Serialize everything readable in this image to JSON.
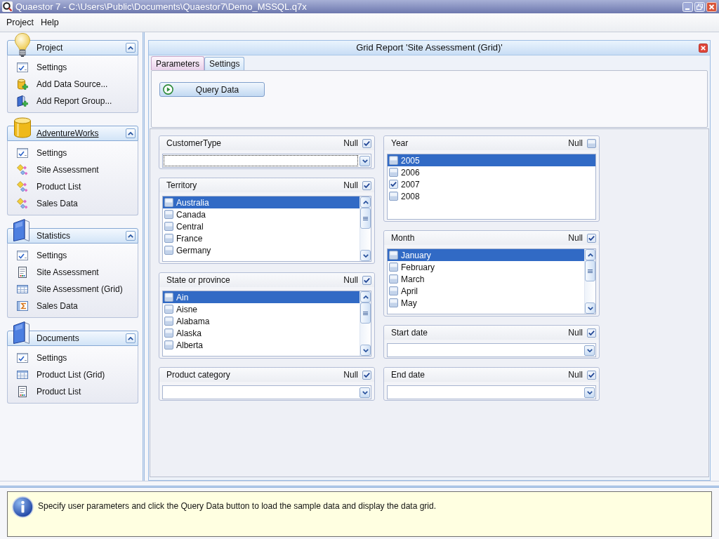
{
  "window": {
    "title": "Quaestor 7 - C:\\Users\\Public\\Documents\\Quaestor7\\Demo_MSSQL.q7x"
  },
  "menu": [
    {
      "label": "Project"
    },
    {
      "label": "Help"
    }
  ],
  "sidebar": {
    "groups": [
      {
        "title": "Project",
        "kind": "bulb",
        "hovered": false,
        "expanded": true,
        "items": [
          {
            "label": "Settings",
            "kind": "settings"
          },
          {
            "label": "Add Data Source...",
            "kind": "add-source"
          },
          {
            "label": "Add Report Group...",
            "kind": "add-group"
          }
        ]
      },
      {
        "title": "AdventureWorks",
        "kind": "database",
        "hovered": true,
        "expanded": true,
        "items": [
          {
            "label": "Settings",
            "kind": "settings"
          },
          {
            "label": "Site Assessment",
            "kind": "query"
          },
          {
            "label": "Product List",
            "kind": "query"
          },
          {
            "label": "Sales Data",
            "kind": "query"
          }
        ]
      },
      {
        "title": "Statistics",
        "kind": "book",
        "hovered": false,
        "expanded": true,
        "items": [
          {
            "label": "Settings",
            "kind": "settings"
          },
          {
            "label": "Site Assessment",
            "kind": "report"
          },
          {
            "label": "Site Assessment (Grid)",
            "kind": "grid"
          },
          {
            "label": "Sales Data",
            "kind": "sum"
          }
        ]
      },
      {
        "title": "Documents",
        "kind": "book",
        "hovered": false,
        "expanded": true,
        "items": [
          {
            "label": "Settings",
            "kind": "settings"
          },
          {
            "label": "Product List (Grid)",
            "kind": "grid"
          },
          {
            "label": "Product List",
            "kind": "report"
          }
        ]
      }
    ]
  },
  "report": {
    "title": "Grid Report 'Site Assessment (Grid)'",
    "tabs": [
      {
        "label": "Parameters",
        "selected": true
      },
      {
        "label": "Settings",
        "selected": false
      }
    ],
    "query_button": {
      "label": "Query Data"
    },
    "parameter_columns": [
      [
        {
          "label": "CustomerType",
          "null_label": "Null",
          "null_checked": true,
          "kind": "combo",
          "focused": true
        },
        {
          "label": "Territory",
          "null_label": "Null",
          "null_checked": true,
          "kind": "list",
          "scrollbar": true,
          "items": [
            {
              "label": "Australia",
              "checked": false,
              "selected": true
            },
            {
              "label": "Canada",
              "checked": false,
              "selected": false
            },
            {
              "label": "Central",
              "checked": false,
              "selected": false
            },
            {
              "label": "France",
              "checked": false,
              "selected": false
            },
            {
              "label": "Germany",
              "checked": false,
              "selected": false
            }
          ]
        },
        {
          "label": "State or province",
          "null_label": "Null",
          "null_checked": true,
          "kind": "list",
          "scrollbar": true,
          "items": [
            {
              "label": "Ain",
              "checked": false,
              "selected": true
            },
            {
              "label": "Aisne",
              "checked": false,
              "selected": false
            },
            {
              "label": "Alabama",
              "checked": false,
              "selected": false
            },
            {
              "label": "Alaska",
              "checked": false,
              "selected": false
            },
            {
              "label": "Alberta",
              "checked": false,
              "selected": false
            }
          ]
        },
        {
          "label": "Product category",
          "null_label": "Null",
          "null_checked": true,
          "kind": "combo",
          "focused": false
        }
      ],
      [
        {
          "label": "Year",
          "null_label": "Null",
          "null_checked": false,
          "kind": "list",
          "scrollbar": false,
          "items": [
            {
              "label": "2005",
              "checked": false,
              "selected": true
            },
            {
              "label": "2006",
              "checked": false,
              "selected": false
            },
            {
              "label": "2007",
              "checked": true,
              "selected": false
            },
            {
              "label": "2008",
              "checked": false,
              "selected": false
            }
          ]
        },
        {
          "label": "Month",
          "null_label": "Null",
          "null_checked": true,
          "kind": "list",
          "scrollbar": true,
          "items": [
            {
              "label": "January",
              "checked": false,
              "selected": true
            },
            {
              "label": "February",
              "checked": false,
              "selected": false
            },
            {
              "label": "March",
              "checked": false,
              "selected": false
            },
            {
              "label": "April",
              "checked": false,
              "selected": false
            },
            {
              "label": "May",
              "checked": false,
              "selected": false
            }
          ]
        },
        {
          "label": "Start date",
          "null_label": "Null",
          "null_checked": true,
          "kind": "combo",
          "focused": false
        },
        {
          "label": "End date",
          "null_label": "Null",
          "null_checked": true,
          "kind": "combo",
          "focused": false
        }
      ]
    ]
  },
  "status": {
    "message": "Specify user parameters and click the Query Data button to load the sample data and display the data grid."
  }
}
